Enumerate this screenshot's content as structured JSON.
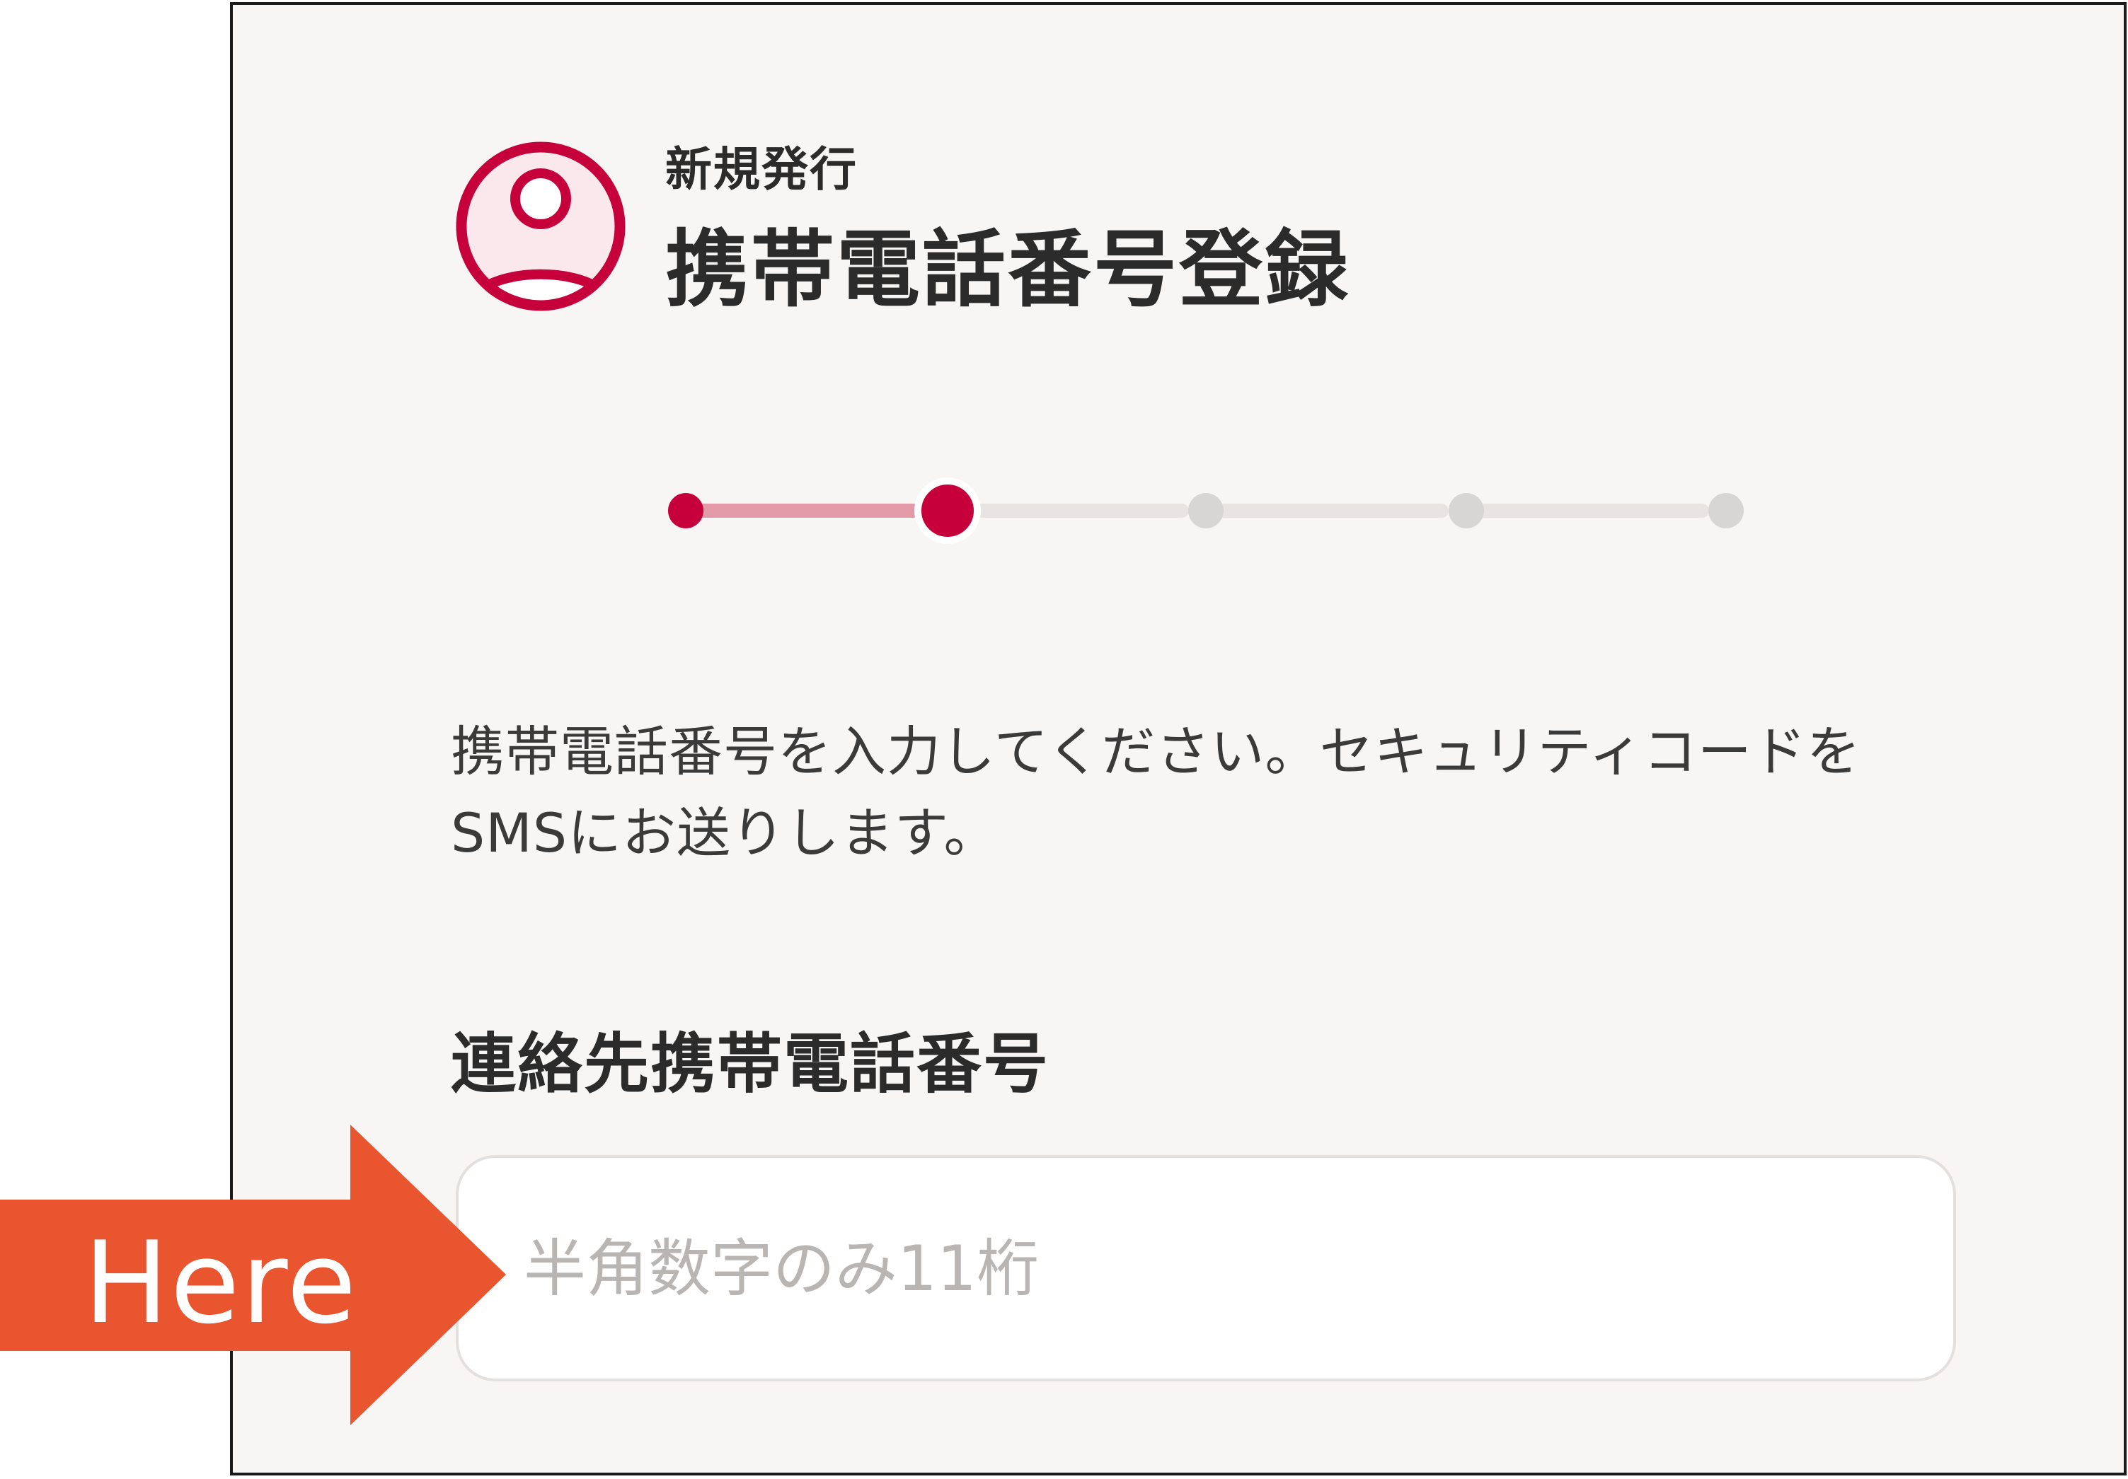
{
  "header": {
    "subtitle": "新規発行",
    "title": "携帯電話番号登録",
    "icon": "user-profile-icon"
  },
  "stepper": {
    "total_steps": 5,
    "current_step": 2,
    "completed_steps": 1
  },
  "description": "携帯電話番号を入力してください。セキュリティコードをSMSにお送りします。",
  "form": {
    "phone_label": "連絡先携帯電話番号",
    "phone_value": "",
    "phone_placeholder": "半角数字のみ11桁"
  },
  "annotation": {
    "label": "Here"
  },
  "colors": {
    "accent": "#c6003a",
    "accent_light": "#e29aa9",
    "annotation": "#e8552f",
    "panel_background": "#f8f6f5"
  }
}
